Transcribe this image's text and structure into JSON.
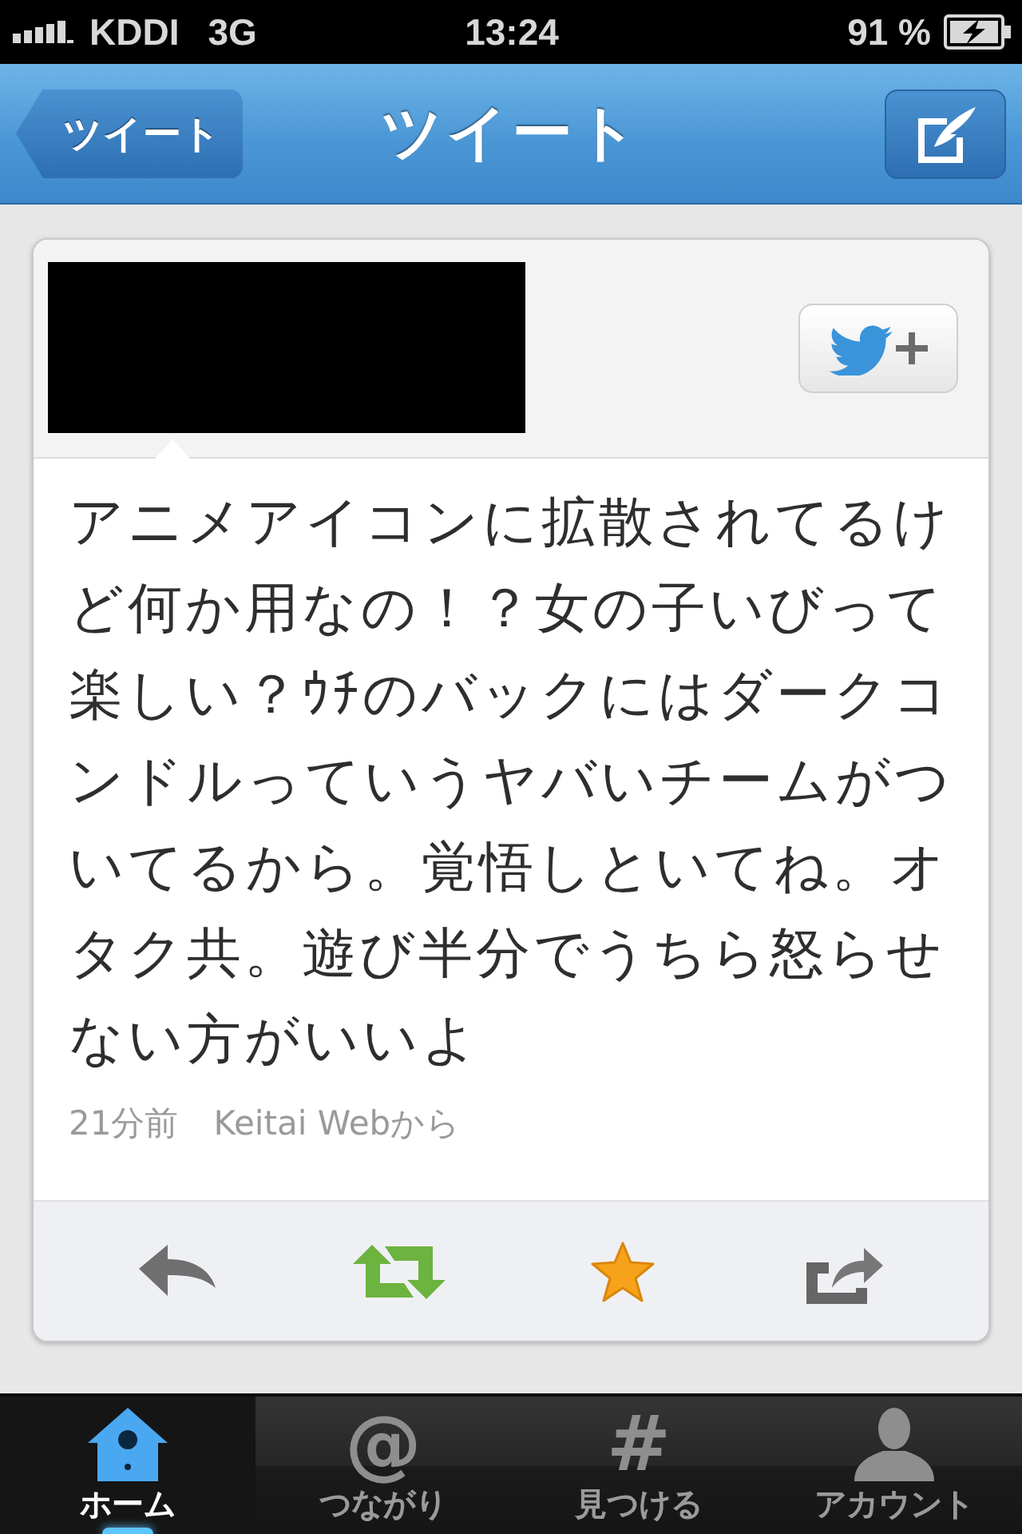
{
  "status_bar": {
    "carrier": "KDDI",
    "network": "3G",
    "time": "13:24",
    "battery": "91 %"
  },
  "nav_bar": {
    "back_button": "ツイート",
    "title": "ツイート"
  },
  "tweet": {
    "text": "アニメアイコンに拡散されてるけど何か用なの！？女の子いびって楽しい？ｳﾁのバックにはダークコンドルっていうヤバいチームがついてるから。覚悟しといてね。オタク共。遊び半分でうちら怒らせない方がいいよ",
    "time": "21分前",
    "source": "Keitai Webから"
  },
  "tab_bar": [
    {
      "kind": "home",
      "label": "ホーム",
      "selected": true
    },
    {
      "kind": "glyph",
      "glyph": "@",
      "label": "つながり",
      "selected": false
    },
    {
      "kind": "glyph",
      "glyph": "#",
      "label": "見つける",
      "selected": false
    },
    {
      "kind": "person",
      "label": "アカウント",
      "selected": false
    }
  ]
}
